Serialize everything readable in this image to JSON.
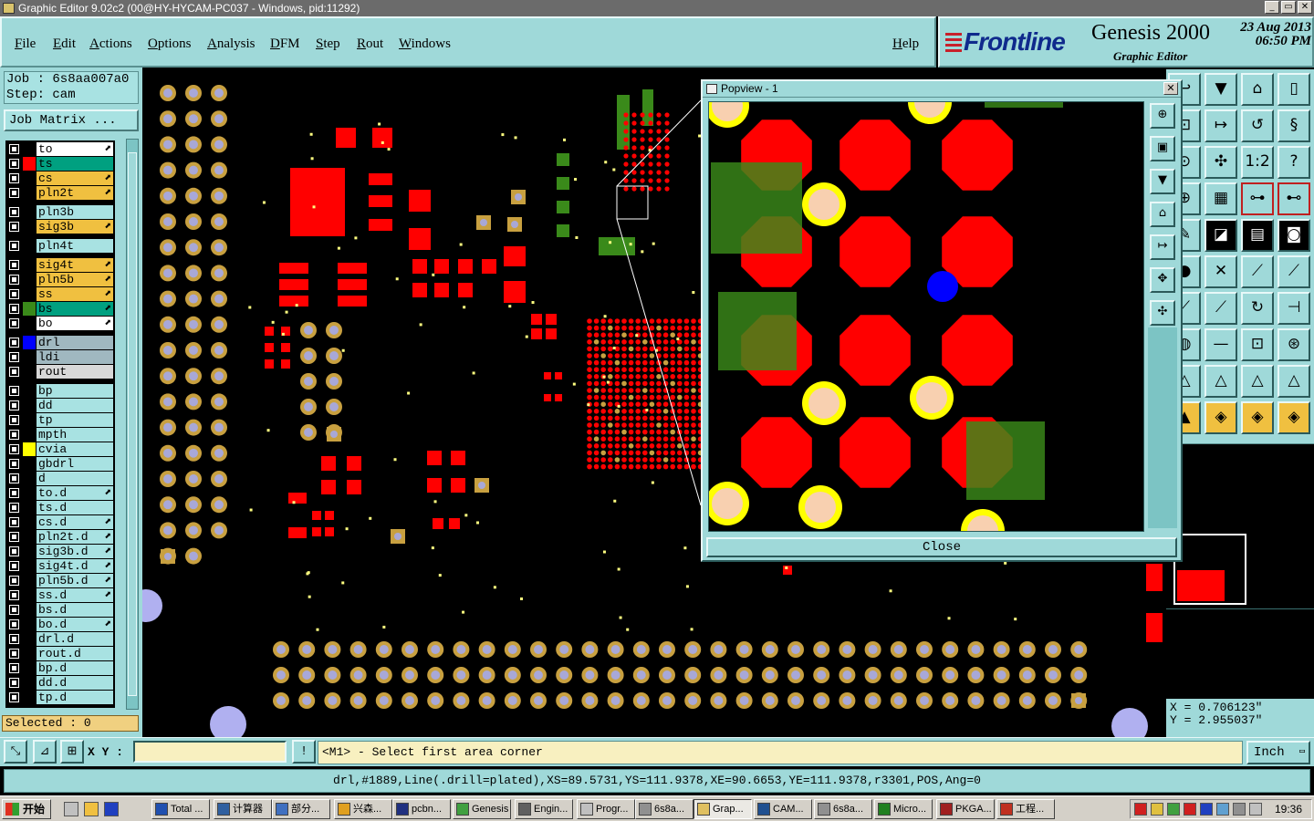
{
  "window": {
    "title": "Graphic Editor 9.02c2 (00@HY-HYCAM-PC037 - Windows, pid:11292)",
    "buttons": [
      "_",
      "▭",
      "✕"
    ]
  },
  "menu": {
    "items": [
      "File",
      "Edit",
      "Actions",
      "Options",
      "Analysis",
      "DFM",
      "Step",
      "Rout",
      "Windows"
    ],
    "help": "Help"
  },
  "brand": {
    "logo": "Frontline",
    "product": "Genesis 2000",
    "subtitle": "Graphic Editor",
    "date": "23  Aug  2013",
    "time": "06:50  PM"
  },
  "job": {
    "job_line": "Job  :  6s8aa007a0",
    "step_line": "Step:  cam",
    "matrix_button": "Job Matrix ..."
  },
  "layers": [
    {
      "name": "to",
      "bg": "#ffffff",
      "swatch": "",
      "mark": true
    },
    {
      "name": "ts",
      "bg": "#00a080",
      "swatch": "#ff0000",
      "mark": false
    },
    {
      "name": "cs",
      "bg": "#f0c040",
      "swatch": "",
      "mark": true
    },
    {
      "name": "pln2t",
      "bg": "#f0c040",
      "swatch": "",
      "mark": true
    },
    {
      "name": "pln3b",
      "bg": "#a8e2e2",
      "swatch": "",
      "mark": false
    },
    {
      "name": "sig3b",
      "bg": "#f0c040",
      "swatch": "",
      "mark": true
    },
    {
      "name": "pln4t",
      "bg": "#a8e2e2",
      "swatch": "",
      "mark": false
    },
    {
      "name": "sig4t",
      "bg": "#f0c040",
      "swatch": "",
      "mark": true
    },
    {
      "name": "pln5b",
      "bg": "#f0c040",
      "swatch": "",
      "mark": true
    },
    {
      "name": "ss",
      "bg": "#f0c040",
      "swatch": "",
      "mark": true
    },
    {
      "name": "bs",
      "bg": "#00a080",
      "swatch": "#3a8a1a",
      "mark": true
    },
    {
      "name": "bo",
      "bg": "#ffffff",
      "swatch": "",
      "mark": true
    },
    {
      "name": "drl",
      "bg": "#a0b8c0",
      "swatch": "#0000ff",
      "mark": false
    },
    {
      "name": "ldi",
      "bg": "#a0b8c0",
      "swatch": "",
      "mark": false
    },
    {
      "name": "rout",
      "bg": "#d8d8d8",
      "swatch": "",
      "mark": false
    },
    {
      "name": "bp",
      "bg": "#a8e2e2",
      "swatch": "",
      "mark": false
    },
    {
      "name": "dd",
      "bg": "#a8e2e2",
      "swatch": "",
      "mark": false
    },
    {
      "name": "tp",
      "bg": "#a8e2e2",
      "swatch": "",
      "mark": false
    },
    {
      "name": "mpth",
      "bg": "#a8e2e2",
      "swatch": "",
      "mark": false
    },
    {
      "name": "cvia",
      "bg": "#a8e2e2",
      "swatch": "#ffff00",
      "mark": false
    },
    {
      "name": "gbdrl",
      "bg": "#a8e2e2",
      "swatch": "",
      "mark": false
    },
    {
      "name": "d",
      "bg": "#a8e2e2",
      "swatch": "",
      "mark": false
    },
    {
      "name": "to.d",
      "bg": "#a8e2e2",
      "swatch": "",
      "mark": true
    },
    {
      "name": "ts.d",
      "bg": "#a8e2e2",
      "swatch": "",
      "mark": false
    },
    {
      "name": "cs.d",
      "bg": "#a8e2e2",
      "swatch": "",
      "mark": true
    },
    {
      "name": "pln2t.d",
      "bg": "#a8e2e2",
      "swatch": "",
      "mark": true
    },
    {
      "name": "sig3b.d",
      "bg": "#a8e2e2",
      "swatch": "",
      "mark": true
    },
    {
      "name": "sig4t.d",
      "bg": "#a8e2e2",
      "swatch": "",
      "mark": true
    },
    {
      "name": "pln5b.d",
      "bg": "#a8e2e2",
      "swatch": "",
      "mark": true
    },
    {
      "name": "ss.d",
      "bg": "#a8e2e2",
      "swatch": "",
      "mark": true
    },
    {
      "name": "bs.d",
      "bg": "#a8e2e2",
      "swatch": "",
      "mark": false
    },
    {
      "name": "bo.d",
      "bg": "#a8e2e2",
      "swatch": "",
      "mark": true
    },
    {
      "name": "drl.d",
      "bg": "#a8e2e2",
      "swatch": "",
      "mark": false
    },
    {
      "name": "rout.d",
      "bg": "#a8e2e2",
      "swatch": "",
      "mark": false
    },
    {
      "name": "bp.d",
      "bg": "#a8e2e2",
      "swatch": "",
      "mark": false
    },
    {
      "name": "dd.d",
      "bg": "#a8e2e2",
      "swatch": "",
      "mark": false
    },
    {
      "name": "tp.d",
      "bg": "#a8e2e2",
      "swatch": "",
      "mark": false
    }
  ],
  "selected": "Selected : 0",
  "popview": {
    "title": "Popview - 1",
    "close_button": "Close"
  },
  "coords": {
    "x": "X = 0.706123\"",
    "y": "Y = 2.955037\""
  },
  "command": {
    "xy_label": "X Y :",
    "xy_value": "",
    "prompt": "<M1> - Select first area corner",
    "units": "Inch"
  },
  "status": "drl,#1889,Line(.drill=plated),XS=89.5731,YS=111.9378,XE=90.6653,YE=111.9378,r3301,POS,Ang=0",
  "taskbar": {
    "start": "开始",
    "tasks": [
      "Total ...",
      "计算器",
      "部分...",
      "兴森...",
      "pcbn...",
      "Genesis",
      "Engin...",
      "Progr...",
      "6s8a...",
      "Grap...",
      "CAM...",
      "6s8a...",
      "Micro...",
      "PKGA...",
      "工程..."
    ],
    "active_task": 9,
    "clock": "19:36"
  },
  "colors": {
    "panel": "#9fd9d9",
    "pad_red": "#ff0000",
    "via_gold": "#c8a040",
    "mask_green": "#3a8a1a",
    "drill_blue": "#0000ff",
    "cvia_yellow": "#ffff00"
  }
}
